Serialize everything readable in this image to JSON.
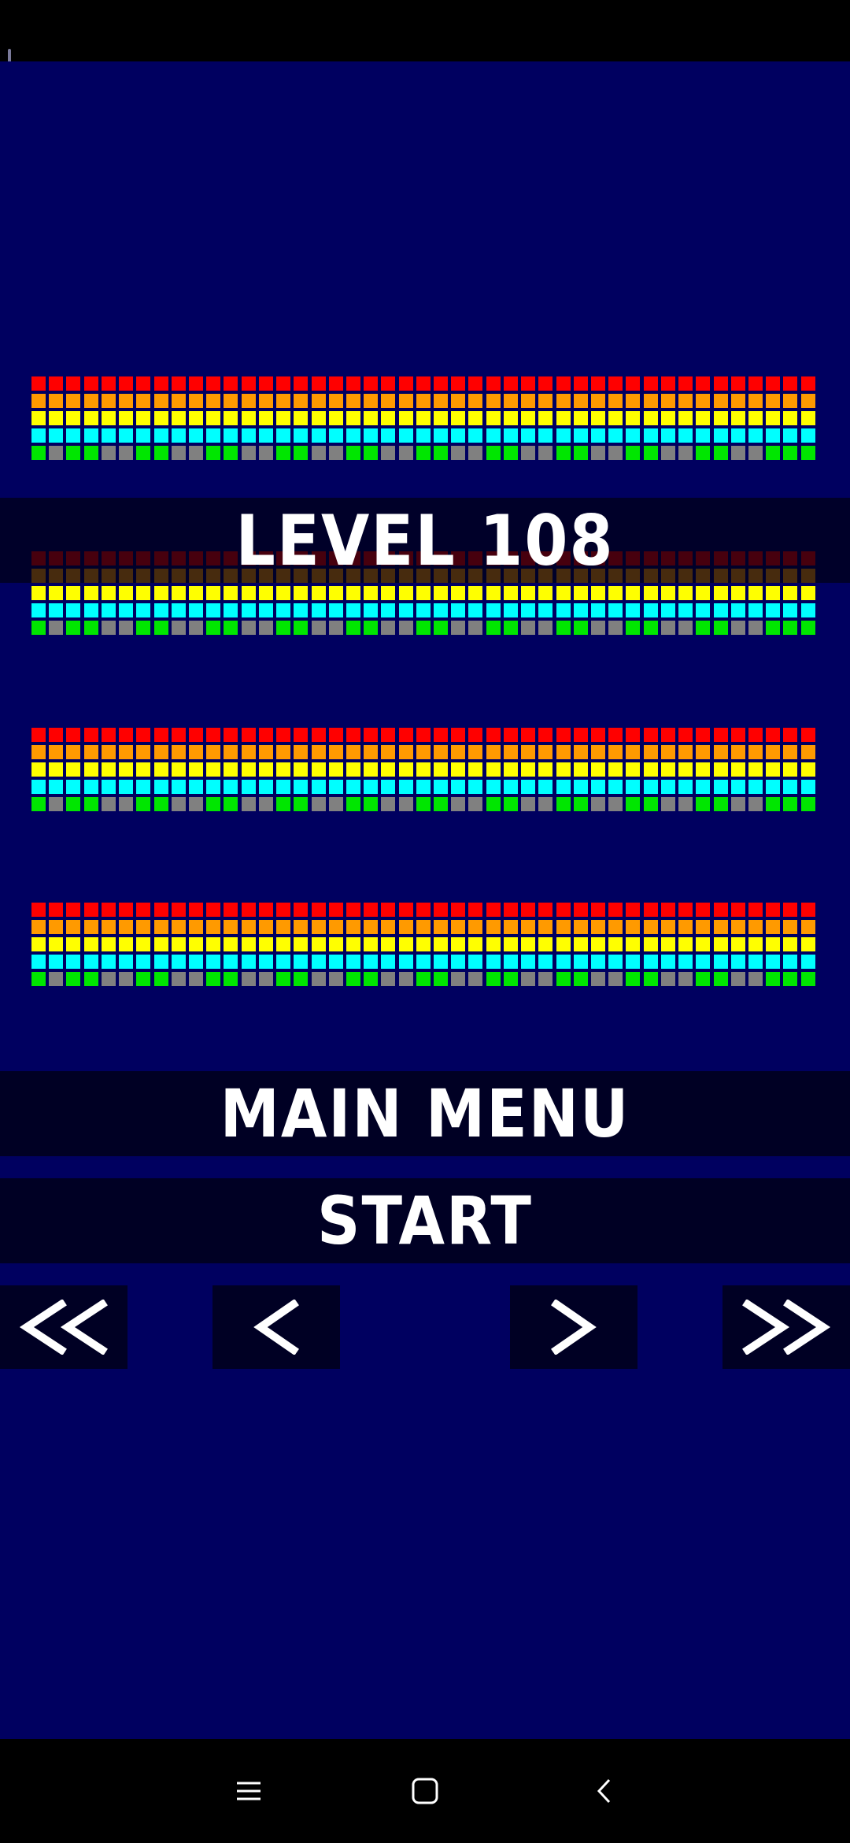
{
  "app": {
    "level_label": "LEVEL 108",
    "main_menu_label": "MAIN MENU",
    "start_label": "START"
  },
  "level_navigation": {
    "first_icon": "double-chevron-left-icon",
    "prev_icon": "chevron-left-icon",
    "next_icon": "chevron-right-icon",
    "last_icon": "double-chevron-right-icon"
  },
  "system_nav": {
    "recents_icon": "menu-lines-icon",
    "home_icon": "rounded-square-icon",
    "back_icon": "chevron-back-icon"
  },
  "colors": {
    "background": "#000060",
    "bar_background": "#000024",
    "row_colors": [
      "#ff0000",
      "#ff9a00",
      "#ffff00",
      "#00ffff"
    ],
    "bottom_row_colors": [
      "#00e600",
      "#808080"
    ]
  },
  "brick_layout": {
    "columns": 45,
    "rows_per_group": 5,
    "groups": 4,
    "bottom_row_pattern": [
      1,
      0,
      1,
      1,
      0,
      0,
      1,
      1,
      0,
      0,
      1,
      1,
      0,
      0,
      1,
      1,
      0,
      0,
      1,
      1,
      0,
      0,
      1,
      1,
      0,
      0,
      1,
      1,
      0,
      0,
      1,
      1,
      0,
      0,
      1,
      1,
      0,
      0,
      1,
      1,
      0,
      0,
      1,
      1,
      1
    ]
  }
}
